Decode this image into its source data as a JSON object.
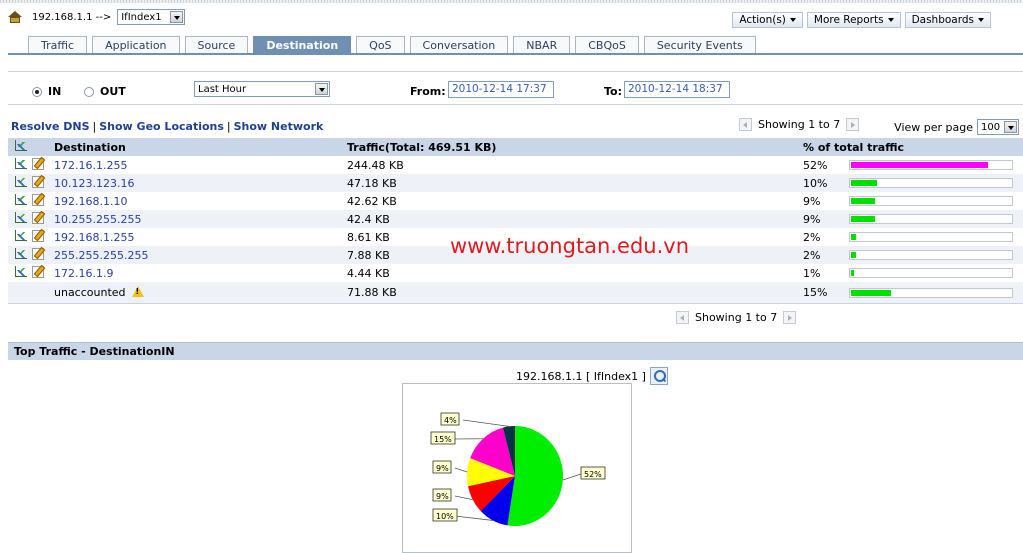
{
  "header": {
    "device_crumb": "192.168.1.1 -->",
    "interface_select": "IfIndex1",
    "menus": [
      {
        "label": "Action(s)"
      },
      {
        "label": "More Reports"
      },
      {
        "label": "Dashboards"
      }
    ]
  },
  "tabs": [
    {
      "label": "Traffic"
    },
    {
      "label": "Application"
    },
    {
      "label": "Source"
    },
    {
      "label": "Destination",
      "active": true
    },
    {
      "label": "QoS"
    },
    {
      "label": "Conversation"
    },
    {
      "label": "NBAR"
    },
    {
      "label": "CBQoS"
    },
    {
      "label": "Security Events"
    }
  ],
  "filters": {
    "in_label": "IN",
    "out_label": "OUT",
    "direction": "IN",
    "period": "Last Hour",
    "from_label": "From:",
    "from_value": "2010-12-14 17:37",
    "to_label": "To:",
    "to_value": "2010-12-14 18:37"
  },
  "links": {
    "resolve_dns": "Resolve DNS",
    "geo": "Show Geo Locations",
    "network": "Show Network"
  },
  "pager": {
    "showing": "Showing 1 to 7",
    "per_page_label": "View per page",
    "per_page_value": "100"
  },
  "table": {
    "headers": {
      "destination": "Destination",
      "traffic": "Traffic(Total: 469.51 KB)",
      "percent": "% of total traffic"
    },
    "rows": [
      {
        "destination": "172.16.1.255",
        "traffic": "244.48 KB",
        "percent": "52%",
        "share": 52,
        "color": "#ff00ff"
      },
      {
        "destination": "10.123.123.16",
        "traffic": "47.18 KB",
        "percent": "10%",
        "share": 10,
        "color": "#00e000"
      },
      {
        "destination": "192.168.1.10",
        "traffic": "42.62 KB",
        "percent": "9%",
        "share": 9,
        "color": "#00e000"
      },
      {
        "destination": "10.255.255.255",
        "traffic": "42.4 KB",
        "percent": "9%",
        "share": 9,
        "color": "#00e000"
      },
      {
        "destination": "192.168.1.255",
        "traffic": "8.61 KB",
        "percent": "2%",
        "share": 2,
        "color": "#00e000"
      },
      {
        "destination": "255.255.255.255",
        "traffic": "7.88 KB",
        "percent": "2%",
        "share": 2,
        "color": "#00e000"
      },
      {
        "destination": "172.16.1.9",
        "traffic": "4.44 KB",
        "percent": "1%",
        "share": 1,
        "color": "#00e000"
      }
    ],
    "unaccounted": {
      "label": "unaccounted",
      "traffic": "71.88 KB",
      "percent": "15%",
      "share": 15,
      "color": "#00e000"
    }
  },
  "watermark": "www.truongtan.edu.vn",
  "panel": {
    "title": "Top Traffic - DestinationIN",
    "chart_title": "192.168.1.1 [ IfIndex1 ]"
  },
  "chart_data": {
    "type": "pie",
    "slices": [
      {
        "label": "52%",
        "value": 52,
        "color": "#00ee00"
      },
      {
        "label": "10%",
        "value": 10,
        "color": "#0000ee"
      },
      {
        "label": "9%",
        "value": 9,
        "color": "#ff0000"
      },
      {
        "label": "9%",
        "value": 9,
        "color": "#ffff00"
      },
      {
        "label": "15%",
        "value": 15,
        "color": "#ff00cc"
      },
      {
        "label": "4%",
        "value": 4,
        "color": "#003344"
      }
    ]
  }
}
